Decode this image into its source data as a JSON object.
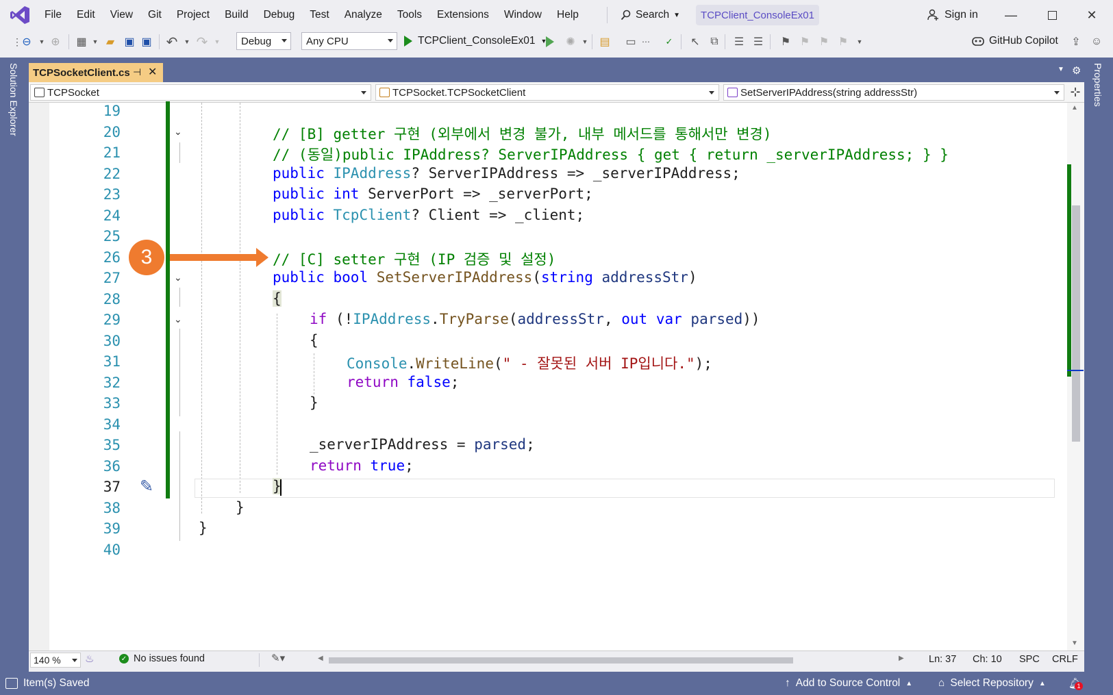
{
  "window": {
    "menu": [
      "File",
      "Edit",
      "View",
      "Git",
      "Project",
      "Build",
      "Debug",
      "Test",
      "Analyze",
      "Tools",
      "Extensions",
      "Window",
      "Help"
    ],
    "search_label": "Search",
    "solution_name": "TCPClient_ConsoleEx01",
    "sign_in": "Sign in"
  },
  "toolbar": {
    "config": "Debug",
    "platform": "Any CPU",
    "startup_project": "TCPClient_ConsoleEx01",
    "copilot": "GitHub Copilot"
  },
  "side_panels": {
    "left": "Solution Explorer",
    "right": "Properties"
  },
  "tab": {
    "file": "TCPSocketClient.cs"
  },
  "navbar": {
    "project": "TCPSocket",
    "class": "TCPSocket.TCPSocketClient",
    "member": "SetServerIPAddress(string addressStr)"
  },
  "editor": {
    "line_numbers": [
      "19",
      "20",
      "21",
      "22",
      "23",
      "24",
      "25",
      "26",
      "27",
      "28",
      "29",
      "30",
      "31",
      "32",
      "33",
      "34",
      "35",
      "36",
      "37",
      "38",
      "39",
      "40"
    ],
    "marker_number": "3",
    "lines": {
      "l20": "// [B] getter 구현 (외부에서 변경 불가, 내부 메서드를 통해서만 변경)",
      "l21": "// (동일)public IPAddress? ServerIPAddress { get { return _serverIPAddress; } }",
      "l26": "// [C] setter 구현 (IP 검증 및 설정)",
      "l31_str": "\" - 잘못된 서버 IP입니다.\""
    }
  },
  "editor_status": {
    "zoom": "140 %",
    "issues": "No issues found",
    "line": "Ln: 37",
    "col": "Ch: 10",
    "spacing": "SPC",
    "line_ending": "CRLF"
  },
  "statusbar": {
    "message": "Item(s) Saved",
    "source_control": "Add to Source Control",
    "repository": "Select Repository",
    "notifications": "1"
  }
}
